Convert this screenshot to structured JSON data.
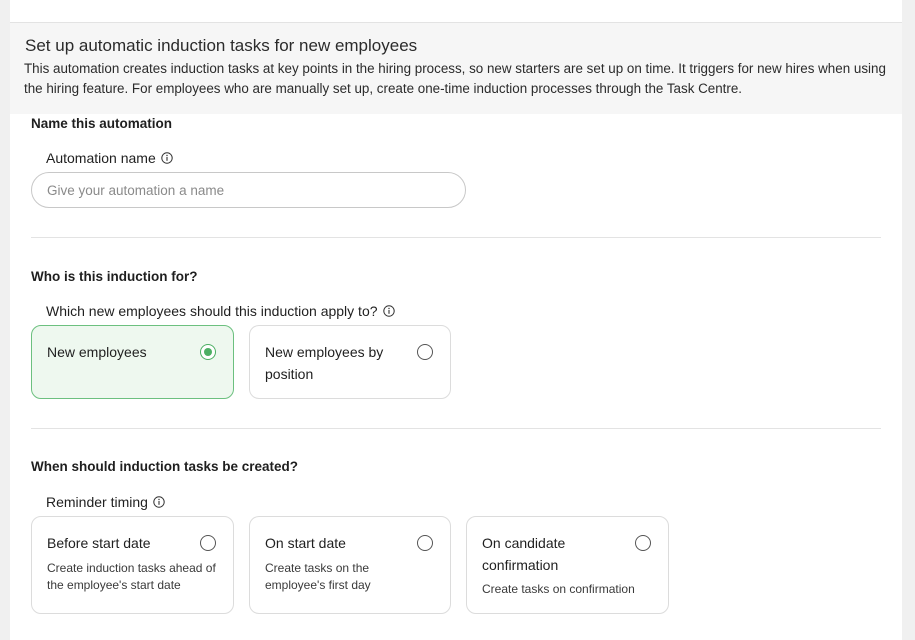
{
  "banner": {
    "title": "Set up automatic induction tasks for new employees",
    "description": "This automation creates induction tasks at key points in the hiring process, so new starters are set up on time. It triggers for new hires when using the hiring feature. For employees who are manually set up, create one-time induction processes through the Task Centre."
  },
  "name_section": {
    "title": "Name this automation",
    "field_label": "Automation name",
    "input_value": "",
    "input_placeholder": "Give your automation a name"
  },
  "who_section": {
    "title": "Who is this induction for?",
    "question": "Which new employees should this induction apply to?",
    "options": [
      {
        "title": "New employees",
        "selected": true
      },
      {
        "title": "New employees by position",
        "selected": false
      }
    ]
  },
  "when_section": {
    "title": "When should induction tasks be created?",
    "field_label": "Reminder timing",
    "options": [
      {
        "title": "Before start date",
        "description": "Create induction tasks ahead of the employee's start date",
        "selected": false
      },
      {
        "title": "On start date",
        "description": "Create tasks on the employee's first day",
        "selected": false
      },
      {
        "title": "On candidate confirmation",
        "description": "Create tasks on confirmation",
        "selected": false
      }
    ]
  },
  "icons": {
    "info": "info-circle-icon",
    "radio": "radio-button-icon"
  },
  "colors": {
    "accent_green": "#4caf63",
    "selected_card_bg": "#eef8ef",
    "selected_card_border": "#6cc07f"
  }
}
